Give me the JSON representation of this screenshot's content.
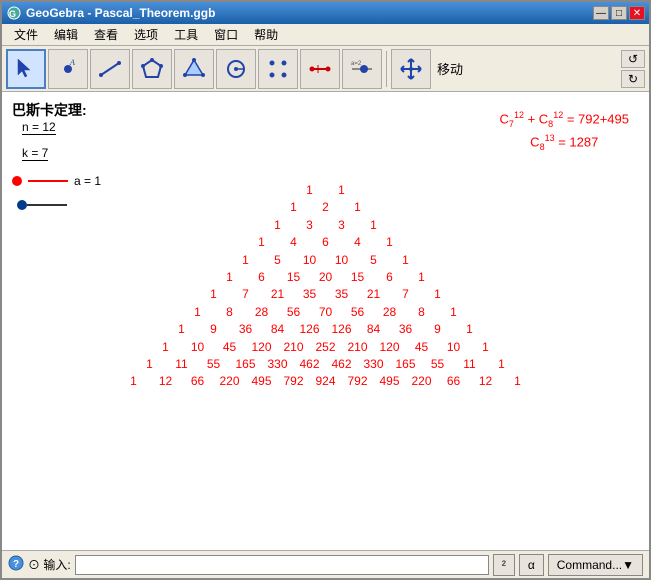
{
  "window": {
    "title": "GeoGebra - Pascal_Theorem.ggb"
  },
  "menu": {
    "items": [
      "文件",
      "编辑",
      "查看",
      "选项",
      "工具",
      "窗口",
      "帮助"
    ]
  },
  "toolbar": {
    "tools": [
      {
        "name": "select",
        "label": ""
      },
      {
        "name": "point",
        "label": "A"
      },
      {
        "name": "line",
        "label": ""
      },
      {
        "name": "polygon",
        "label": ""
      },
      {
        "name": "triangle",
        "label": ""
      },
      {
        "name": "circle",
        "label": ""
      },
      {
        "name": "points",
        "label": ""
      },
      {
        "name": "segment",
        "label": ""
      },
      {
        "name": "slider",
        "label": "a=2"
      },
      {
        "name": "move",
        "label": ""
      }
    ],
    "move_label": "移动",
    "undo_label": "↺",
    "redo_label": "↻"
  },
  "content": {
    "title": "巴斯卡定理:",
    "n_label": "n = 12",
    "k_label": "k = 7",
    "a_label": "a = 1",
    "formula1": "C₇¹² + C₈¹² = 792+495",
    "formula2": "C₈¹³ = 1287",
    "triangle": [
      [
        "1",
        "1"
      ],
      [
        "1",
        "2",
        "1"
      ],
      [
        "1",
        "3",
        "3",
        "1"
      ],
      [
        "1",
        "4",
        "6",
        "4",
        "1"
      ],
      [
        "1",
        "5",
        "10",
        "10",
        "5",
        "1"
      ],
      [
        "1",
        "6",
        "15",
        "20",
        "15",
        "6",
        "1"
      ],
      [
        "1",
        "7",
        "21",
        "35",
        "35",
        "21",
        "7",
        "1"
      ],
      [
        "1",
        "8",
        "28",
        "56",
        "70",
        "56",
        "28",
        "8",
        "1"
      ],
      [
        "1",
        "9",
        "36",
        "84",
        "126",
        "126",
        "84",
        "36",
        "9",
        "1"
      ],
      [
        "1",
        "10",
        "45",
        "120",
        "210",
        "252",
        "210",
        "120",
        "45",
        "10",
        "1"
      ],
      [
        "1",
        "11",
        "55",
        "165",
        "330",
        "462",
        "462",
        "330",
        "165",
        "55",
        "11",
        "1"
      ],
      [
        "1",
        "12",
        "66",
        "220",
        "495",
        "792",
        "924",
        "792",
        "495",
        "220",
        "66",
        "12",
        "1"
      ]
    ]
  },
  "statusbar": {
    "help_label": "⊙ 输入:",
    "btn1_label": "²",
    "btn2_label": "α",
    "cmd_label": "Command...",
    "cmd_arrow": "▼"
  }
}
